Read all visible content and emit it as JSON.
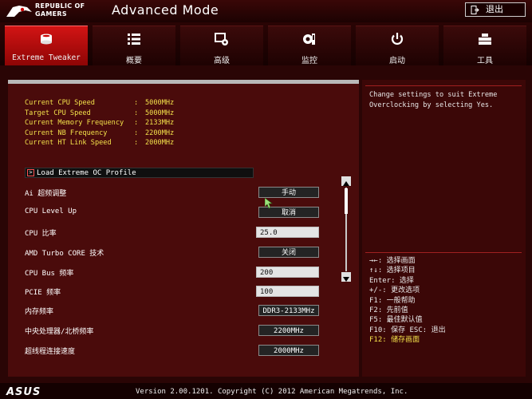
{
  "header": {
    "brand_line1": "REPUBLIC OF",
    "brand_line2": "GAMERS",
    "title": "Advanced Mode",
    "exit_label": "退出"
  },
  "tabs": [
    {
      "label": "Extreme Tweaker",
      "icon": "cpu-chip-icon",
      "active": true
    },
    {
      "label": "概要",
      "icon": "list-icon",
      "active": false
    },
    {
      "label": "高级",
      "icon": "advanced-settings-icon",
      "active": false
    },
    {
      "label": "监控",
      "icon": "monitor-icon",
      "active": false
    },
    {
      "label": "启动",
      "icon": "power-icon",
      "active": false
    },
    {
      "label": "工具",
      "icon": "tools-icon",
      "active": false
    }
  ],
  "info": [
    {
      "label": "Current CPU Speed",
      "value": "5000MHz"
    },
    {
      "label": "Target CPU Speed",
      "value": "5000MHz"
    },
    {
      "label": "Current Memory Frequency",
      "value": "2133MHz"
    },
    {
      "label": "Current NB Frequency",
      "value": "2200MHz"
    },
    {
      "label": "Current HT Link Speed",
      "value": "2000MHz"
    }
  ],
  "oc_profile_label": "Load Extreme OC Profile",
  "settings": [
    {
      "label": "Ai 超频调整",
      "value": "手动"
    },
    {
      "label": "CPU Level Up",
      "value": "取消"
    },
    {
      "label": "CPU 比率",
      "value": "25.0"
    },
    {
      "label": "AMD Turbo CORE 技术",
      "value": "关闭"
    },
    {
      "label": "CPU Bus 频率",
      "value": "200"
    },
    {
      "label": "PCIE 频率",
      "value": "100"
    },
    {
      "label": "内存频率",
      "value": "DDR3-2133MHz"
    },
    {
      "label": "中央处理器/北桥频率",
      "value": "2200MHz"
    },
    {
      "label": "超线程连接速度",
      "value": "2000MHz"
    }
  ],
  "help": "Change settings to suit Extreme Overclocking by selecting Yes.",
  "keys": [
    "→←: 选择画面",
    "↑↓: 选择项目",
    "Enter: 选择",
    "+/-: 更改选项",
    "F1: 一般帮助",
    "F2: 先前值",
    "F5: 最佳默认值",
    "F10: 保存  ESC: 退出",
    "F12: 储存画面"
  ],
  "footer": {
    "brand": "ASUS",
    "version": "Version 2.00.1201. Copyright (C) 2012 American Megatrends, Inc."
  },
  "colors": {
    "accent_red": "#d21414",
    "info_yellow": "#f2e04a",
    "background": "#1a0303"
  }
}
